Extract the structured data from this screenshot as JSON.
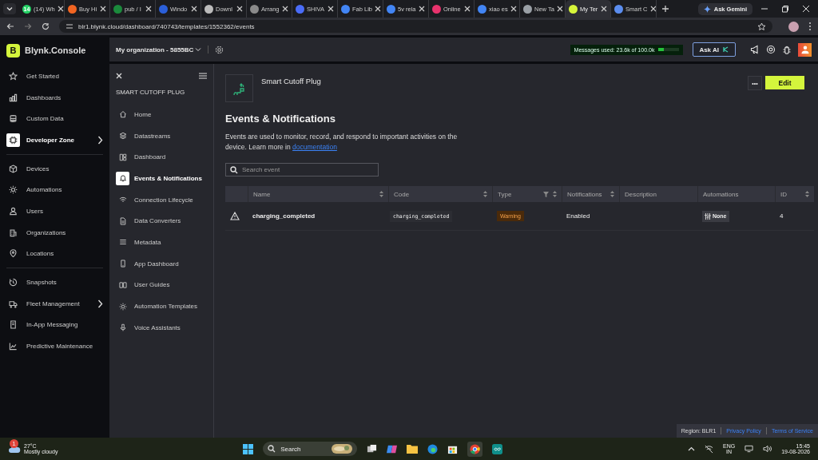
{
  "browser": {
    "tabs": [
      {
        "title": "(14) Wh",
        "color": "#25d366",
        "badge": "14",
        "selected": false
      },
      {
        "title": "Buy Hi",
        "color": "#f26522",
        "selected": false
      },
      {
        "title": "pub / I",
        "color": "#1b8a3c",
        "selected": false
      },
      {
        "title": "Windo",
        "color": "#2b5fd9",
        "selected": false
      },
      {
        "title": "Downl",
        "color": "#bbbbbb",
        "selected": false
      },
      {
        "title": "Arrang",
        "color": "#8a8a8a",
        "selected": false
      },
      {
        "title": "SHIVA",
        "color": "#4a6cf7",
        "selected": false
      },
      {
        "title": "Fab Lib",
        "color": "#4285f4",
        "selected": false
      },
      {
        "title": "5v rela",
        "color": "#4285f4",
        "selected": false
      },
      {
        "title": "Online",
        "color": "#e8336d",
        "selected": false
      },
      {
        "title": "xiao es",
        "color": "#4285f4",
        "selected": false
      },
      {
        "title": "New Ta",
        "color": "#9aa0a6",
        "selected": false
      },
      {
        "title": "My Ter",
        "color": "#d7f53a",
        "selected": true
      },
      {
        "title": "Smart C",
        "color": "#5b8def",
        "selected": false
      }
    ],
    "gemini": "Ask Gemini",
    "url": "blr1.blynk.cloud/dashboard/740743/templates/1552362/events"
  },
  "app": {
    "logo": "Blynk.Console",
    "logo_letter": "B",
    "sidebar": [
      [
        {
          "label": "Get Started",
          "selected": false,
          "expandable": false
        },
        {
          "label": "Dashboards",
          "selected": false,
          "expandable": false
        },
        {
          "label": "Custom Data",
          "selected": false,
          "expandable": false
        },
        {
          "label": "Developer Zone",
          "selected": true,
          "expandable": true
        }
      ],
      [
        {
          "label": "Devices",
          "selected": false,
          "expandable": false
        },
        {
          "label": "Automations",
          "selected": false,
          "expandable": false
        },
        {
          "label": "Users",
          "selected": false,
          "expandable": false
        },
        {
          "label": "Organizations",
          "selected": false,
          "expandable": false
        },
        {
          "label": "Locations",
          "selected": false,
          "expandable": false
        }
      ],
      [
        {
          "label": "Snapshots",
          "selected": false,
          "expandable": false
        },
        {
          "label": "Fleet Management",
          "selected": false,
          "expandable": true
        },
        {
          "label": "In-App Messaging",
          "selected": false,
          "expandable": false
        },
        {
          "label": "Predictive Maintenance",
          "selected": false,
          "expandable": false
        }
      ]
    ],
    "header": {
      "organization": "My organization - 5855BC",
      "messages": {
        "text": "Messages used: 23.6k of 100.0k",
        "level": 0.236
      },
      "ask_ai": "Ask AI"
    },
    "template_menu": {
      "title": "SMART CUTOFF PLUG",
      "items": [
        {
          "label": "Home",
          "selected": false
        },
        {
          "label": "Datastreams",
          "selected": false
        },
        {
          "label": "Dashboard",
          "selected": false
        },
        {
          "label": "Events & Notifications",
          "selected": true
        },
        {
          "label": "Connection Lifecycle",
          "selected": false
        },
        {
          "label": "Data Converters",
          "selected": false
        },
        {
          "label": "Metadata",
          "selected": false
        },
        {
          "label": "App Dashboard",
          "selected": false
        },
        {
          "label": "User Guides",
          "selected": false
        },
        {
          "label": "Automation Templates",
          "selected": false
        },
        {
          "label": "Voice Assistants",
          "selected": false
        }
      ]
    },
    "template_name": "Smart Cutoff Plug",
    "edit": "Edit",
    "more": "•••",
    "heading": "Events & Notifications",
    "description": "Events are used to monitor, record, and respond to important activities on the device. Learn more in ",
    "link": "documentation",
    "search": {
      "placeholder": "Search event"
    },
    "table": {
      "columns": [
        {
          "label": "Name",
          "sortable": true,
          "filter": false
        },
        {
          "label": "Code",
          "sortable": true,
          "filter": false
        },
        {
          "label": "Type",
          "sortable": true,
          "filter": true
        },
        {
          "label": "Notifications",
          "sortable": true,
          "filter": false
        },
        {
          "label": "Description",
          "sortable": false,
          "filter": false
        },
        {
          "label": "Automations",
          "sortable": false,
          "filter": false
        },
        {
          "label": "ID",
          "sortable": true,
          "filter": false
        }
      ],
      "rows": [
        {
          "kind": "warning",
          "name": "charging_completed",
          "code": "charging_completed",
          "type": "Warning",
          "notifications": "Enabled",
          "automations": "None",
          "id": "4"
        }
      ]
    },
    "footer": {
      "region": "Region: BLR1",
      "links": [
        "Privacy Policy",
        "Terms of Service"
      ]
    }
  },
  "taskbar": {
    "temperature": "27°C",
    "weather": "Mostly cloudy",
    "weather_badge": "1",
    "search": "Search",
    "language": "ENG",
    "region": "IN",
    "time": "15:45",
    "date": "19-08-2026"
  }
}
